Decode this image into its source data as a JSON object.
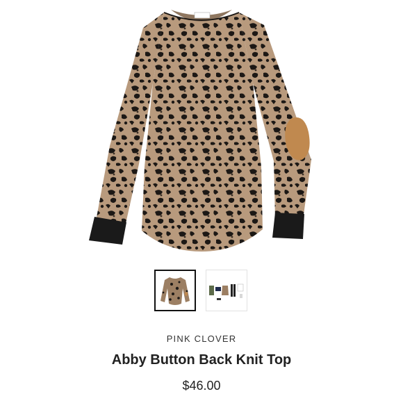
{
  "product": {
    "brand": "PINK CLOVER",
    "name": "Abby Button Back Knit Top",
    "price": "$46.00",
    "label_tag": "Pink Clover"
  },
  "gallery": {
    "selected_index": 0,
    "thumbnails": [
      {
        "icon": "leopard-top-thumbnail"
      },
      {
        "icon": "outfit-styling-thumbnail"
      }
    ]
  },
  "colors": {
    "leopard_base": "#b89a7d",
    "leopard_spots": "#1c1815",
    "elbow_patch": "#c0894f",
    "cuff": "#1a1a1a"
  }
}
